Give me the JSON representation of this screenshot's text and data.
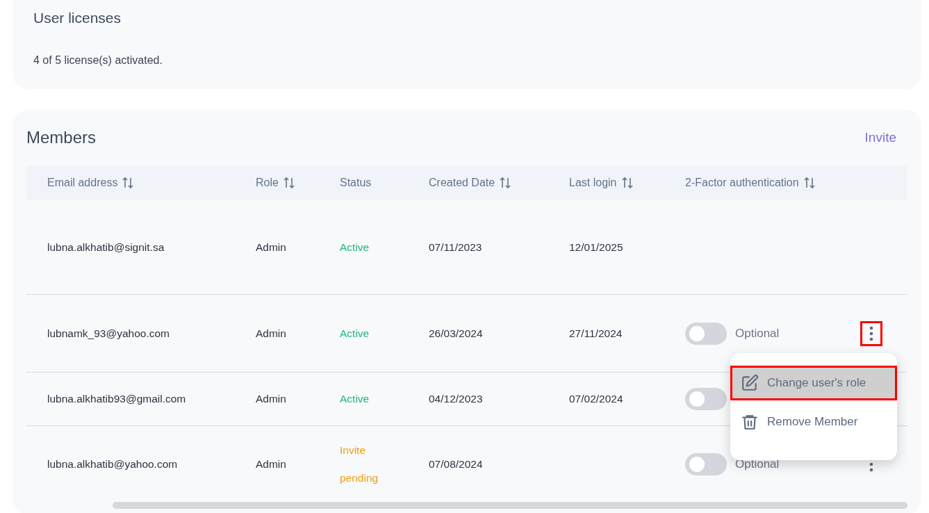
{
  "licenses": {
    "title": "User licenses",
    "summary": "4 of 5 license(s) activated."
  },
  "members": {
    "title": "Members",
    "invite": "Invite",
    "columns": [
      {
        "label": "Email address",
        "sortable": true
      },
      {
        "label": "Role",
        "sortable": true
      },
      {
        "label": "Status",
        "sortable": false
      },
      {
        "label": "Created Date",
        "sortable": true
      },
      {
        "label": "Last login",
        "sortable": true
      },
      {
        "label": "2-Factor authentication",
        "sortable": true
      }
    ],
    "rows": [
      {
        "email": "lubna.alkhatib@signit.sa",
        "role": "Admin",
        "status": "Active",
        "kind": "active",
        "created": "07/11/2023",
        "last_login": "12/01/2025"
      },
      {
        "email": "lubnamk_93@yahoo.com",
        "role": "Admin",
        "status": "Active",
        "kind": "active",
        "created": "26/03/2024",
        "last_login": "27/11/2024",
        "two_factor": {
          "on": false,
          "label": "Optional"
        },
        "menu": {
          "highlighted": true
        }
      },
      {
        "email": "lubna.alkhatib93@gmail.com",
        "role": "Admin",
        "status": "Active",
        "kind": "active",
        "created": "04/12/2023",
        "last_login": "07/02/2024",
        "two_factor": {
          "on": false
        }
      },
      {
        "email": "lubna.alkhatib@yahoo.com",
        "role": "Admin",
        "status": "Invite pending",
        "kind": "pending",
        "created": "07/08/2024",
        "two_factor": {
          "on": false,
          "label": "Optional"
        },
        "menu": {
          "highlighted": false
        }
      }
    ],
    "context_menu": {
      "items": [
        {
          "kind": "edit",
          "label": "Change user's role",
          "selected": true,
          "highlighted": true
        },
        {
          "kind": "delete",
          "label": "Remove Member",
          "selected": false,
          "highlighted": false
        }
      ]
    }
  }
}
